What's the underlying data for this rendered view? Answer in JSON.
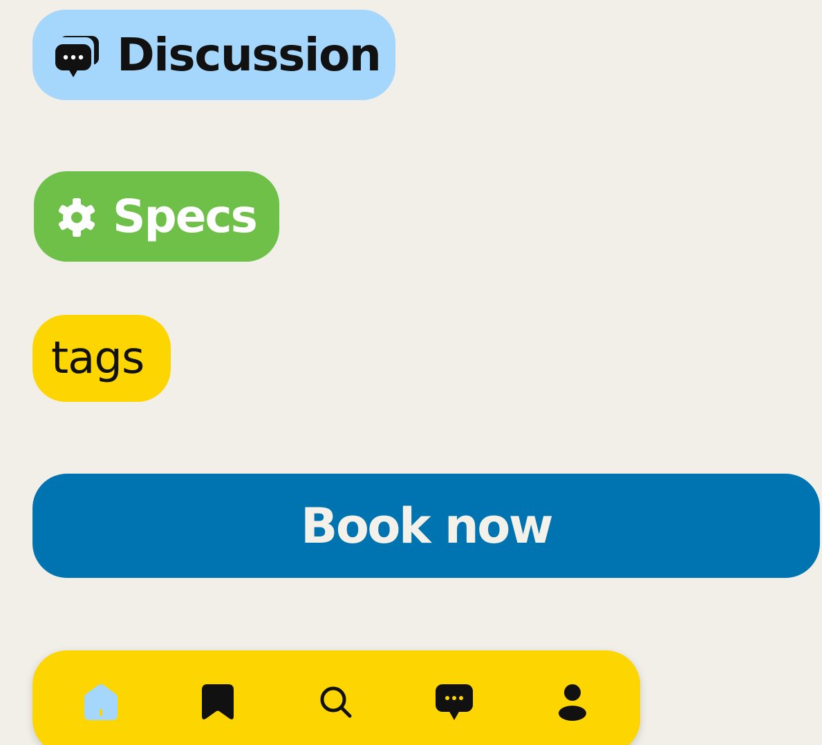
{
  "chips": {
    "discussion": {
      "label": "Discussion",
      "icon": "chat-bubbles-icon",
      "color": "#a5d6fb"
    },
    "specs": {
      "label": "Specs",
      "icon": "gear-icon",
      "color": "#6ec048"
    },
    "tags": {
      "label": "tags",
      "color": "#fdd601"
    }
  },
  "book_button": {
    "label": "Book now",
    "color": "#0074b1"
  },
  "nav": {
    "background": "#fdd601",
    "items": [
      {
        "id": "home",
        "icon": "home-icon",
        "active": true,
        "active_color": "#a5d6fb"
      },
      {
        "id": "saved",
        "icon": "bookmark-icon"
      },
      {
        "id": "search",
        "icon": "search-icon"
      },
      {
        "id": "messages",
        "icon": "chat-icon"
      },
      {
        "id": "profile",
        "icon": "user-icon"
      }
    ]
  },
  "colors": {
    "background": "#f2efe9",
    "text_dark": "#111111",
    "text_light": "#f4f1ea"
  }
}
